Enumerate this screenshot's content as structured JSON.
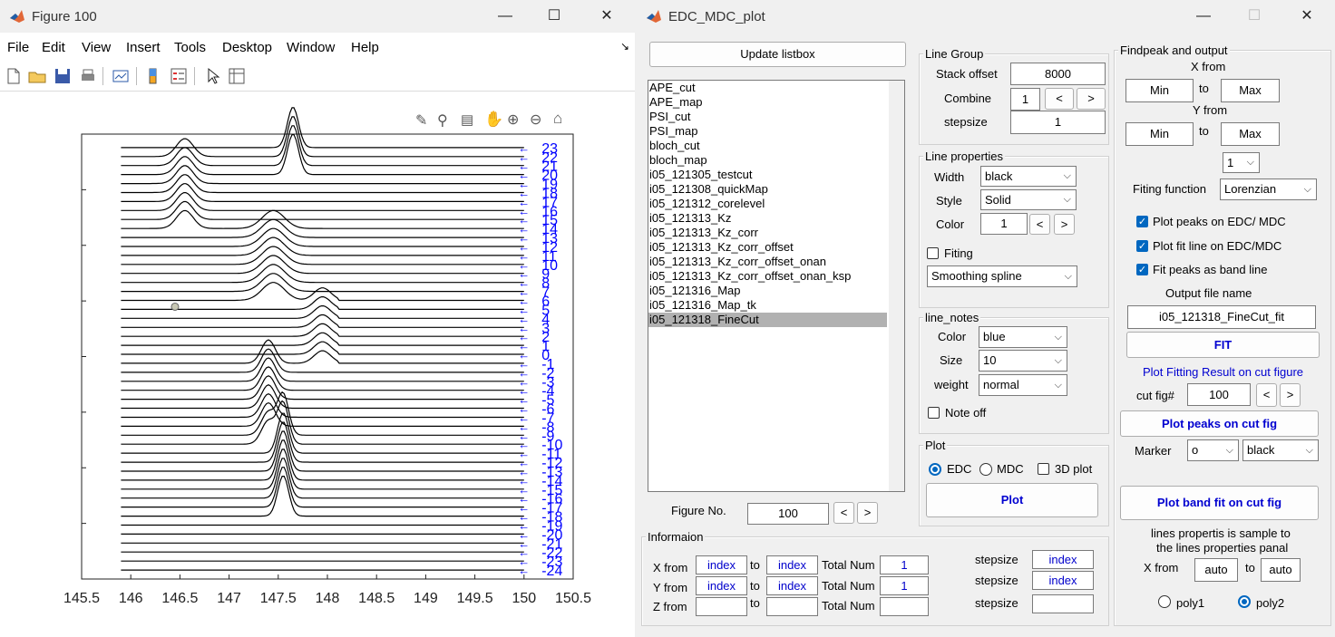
{
  "figure_window": {
    "title": "Figure 100",
    "menus": [
      "File",
      "Edit",
      "View",
      "Insert",
      "Tools",
      "Desktop",
      "Window",
      "Help"
    ],
    "toolbar_icons": [
      "new-file-icon",
      "open-folder-icon",
      "save-icon",
      "print-icon",
      "link-plot-icon",
      "colorbar-icon",
      "legend-icon",
      "pointer-icon",
      "property-inspector-icon"
    ],
    "axes_toolbar_icons": [
      "brush-icon",
      "data-tips-icon",
      "export-icon",
      "pan-icon",
      "zoom-in-icon",
      "zoom-out-icon",
      "home-icon"
    ]
  },
  "chart_data": {
    "type": "line",
    "x_ticks": [
      "145.5",
      "146",
      "146.5",
      "147",
      "147.5",
      "148",
      "148.5",
      "149",
      "149.5",
      "150",
      "150.5"
    ],
    "xlim": [
      145.5,
      150.5
    ],
    "ylim": [
      -25,
      24.5
    ],
    "series_count": 48,
    "line_color": "#000000",
    "curve_range": [
      145.9,
      148.5
    ],
    "label_x": 150.05,
    "arrow_color": "#0000ff",
    "y_minor_ticks": 8,
    "labels": [
      "23",
      "22",
      "21",
      "20",
      "19",
      "18",
      "17",
      "16",
      "15",
      "14",
      "13",
      "12",
      "11",
      "10",
      "9",
      "8",
      "7",
      "6",
      "5",
      "4",
      "3",
      "2",
      "1",
      "0",
      "-1",
      "-2",
      "-3",
      "-4",
      "-5",
      "-6",
      "-7",
      "-8",
      "-9",
      "-10",
      "-11",
      "-12",
      "-13",
      "-14",
      "-15",
      "-16",
      "-17",
      "-18",
      "-19",
      "-20",
      "-21",
      "-22",
      "-23",
      "-24"
    ],
    "peaks": [
      {
        "x": 147.65,
        "height": 4.5,
        "width": 0.08
      },
      {
        "x": 146.55,
        "height": 2.0,
        "width": 0.12
      },
      {
        "x": 147.45,
        "height": 2.0,
        "width": 0.16
      },
      {
        "x": 147.95,
        "height": 1.4,
        "width": 0.12
      },
      {
        "x": 147.4,
        "height": 2.6,
        "width": 0.1
      },
      {
        "x": 147.55,
        "height": 4.5,
        "width": 0.08
      }
    ],
    "marker_point": {
      "x": 146.45,
      "y": 5.3
    }
  },
  "gui_window": {
    "title": "EDC_MDC_plot",
    "update_listbox": "Update listbox",
    "list_items": [
      "APE_cut",
      "APE_map",
      "PSI_cut",
      "PSI_map",
      "bloch_cut",
      "bloch_map",
      "i05_121305_testcut",
      "i05_121308_quickMap",
      "i05_121312_corelevel",
      "i05_121313_Kz",
      "i05_121313_Kz_corr",
      "i05_121313_Kz_corr_offset",
      "i05_121313_Kz_corr_offset_onan",
      "i05_121313_Kz_corr_offset_onan_ksp",
      "i05_121316_Map",
      "i05_121316_Map_tk",
      "i05_121318_FineCut"
    ],
    "selected_item": "i05_121318_FineCut",
    "figure_no_label": "Figure No.",
    "figure_no": "100",
    "line_group": {
      "title": "Line Group",
      "stack_offset_label": "Stack offset",
      "stack_offset": "8000",
      "combine_label": "Combine",
      "combine": "1",
      "stepsize_label": "stepsize",
      "stepsize": "1"
    },
    "line_properties": {
      "title": "Line properties",
      "width_label": "Width",
      "width": "black",
      "style_label": "Style",
      "style": "Solid",
      "color_label": "Color",
      "color": "1",
      "fiting_label": "Fiting",
      "smoothing": "Smoothing spline"
    },
    "line_notes": {
      "title": "line_notes",
      "color_label": "Color",
      "color": "blue",
      "size_label": "Size",
      "size": "10",
      "weight_label": "weight",
      "weight": "normal",
      "note_off_label": "Note off"
    },
    "plot_panel": {
      "title": "Plot",
      "edc": "EDC",
      "mdc": "MDC",
      "plot3d": "3D plot",
      "plot_button": "Plot"
    },
    "information": {
      "title": "Informaion",
      "x_from": "X from",
      "y_from": "Y from",
      "z_from": "Z from",
      "to": "to",
      "total_num": "Total Num",
      "stepsize": "stepsize",
      "x_from_val": "index",
      "x_to_val": "index",
      "x_total": "1",
      "x_step": "index",
      "y_from_val": "index",
      "y_to_val": "index",
      "y_total": "1",
      "y_step": "index",
      "z_from_val": "",
      "z_to_val": "",
      "z_total": "",
      "z_step": ""
    },
    "findpeak": {
      "title": "Findpeak and output",
      "x_from_label": "X from",
      "x_min": "Min",
      "x_max": "Max",
      "y_from_label": "Y from",
      "y_min": "Min",
      "y_max": "Max",
      "to": "to",
      "order": "1",
      "fit_func_label": "Fiting function",
      "fit_func": "Lorenzian",
      "chk1": "Plot peaks on EDC/ MDC",
      "chk2": "Plot fit line on EDC/MDC",
      "chk3": "Fit peaks as band line",
      "output_label": "Output file name",
      "output_name": "i05_121318_FineCut_fit",
      "fit_button": "FIT",
      "plot_result_label": "Plot Fitting Result on cut figure",
      "cut_fig_label": "cut fig#",
      "cut_fig": "100",
      "plot_peaks_button": "Plot peaks on cut fig",
      "marker_label": "Marker",
      "marker": "o",
      "marker_color": "black",
      "plot_band_button": "Plot band fit on cut fig",
      "note1": "lines propertis is sample to",
      "note2": "the lines properties panal",
      "xfrom_label": "X from",
      "auto1": "auto",
      "auto2": "auto",
      "poly1": "poly1",
      "poly2": "poly2"
    }
  }
}
